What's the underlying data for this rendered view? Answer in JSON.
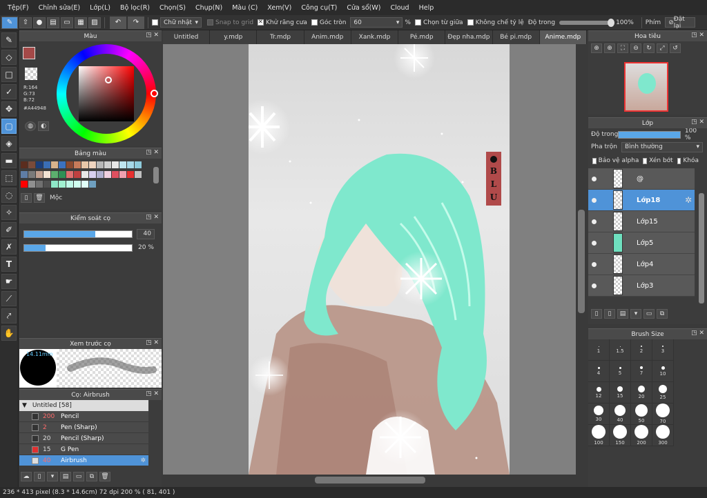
{
  "menu": [
    "Tệp(F)",
    "Chỉnh sửa(E)",
    "Lớp(L)",
    "Bộ lọc(R)",
    "Chọn(S)",
    "Chụp(N)",
    "Màu (C)",
    "Xem(V)",
    "Công cụ(T)",
    "Cửa sổ(W)",
    "Cloud",
    "Help"
  ],
  "toolbar": {
    "brush_mode": "Chữ nhật",
    "snap": "Snap to grid",
    "antialias": "Khử răng cưa",
    "corner": "Góc tròn",
    "corner_value": "60",
    "percent": "%",
    "select_center": "Chọn từ giữa",
    "no_ratio": "Không chế tỷ lệ",
    "opacity": "Độ trong",
    "opacity_value": "100%",
    "key": "Phím",
    "reset": "Đặt lại"
  },
  "color_panel": {
    "title": "Màu",
    "r": "R:164",
    "g": "G:73",
    "b": "B:72",
    "hex": "#A44948",
    "main_color": "#A44948"
  },
  "palette_panel": {
    "title": "Bảng màu",
    "name": "Mộc"
  },
  "brush_control": {
    "title": "Kiểm soát cọ",
    "size": "40",
    "opacity": "20 %",
    "size_fill": 0.66,
    "opacity_fill": 0.2
  },
  "brush_preview": {
    "title": "Xem trước cọ",
    "size_label": "14.11mm"
  },
  "brush_list": {
    "title": "Cọ: Airbrush",
    "group": "Untitled [58]",
    "items": [
      {
        "num": "200",
        "name": "Pencil",
        "color": "#333",
        "num_color": "#ff6b6b",
        "on": false
      },
      {
        "num": "2",
        "name": "Pen (Sharp)",
        "color": "#333",
        "num_color": "#ff6b6b",
        "on": false
      },
      {
        "num": "20",
        "name": "Pencil (Sharp)",
        "color": "#333",
        "num_color": "#ddd",
        "on": false
      },
      {
        "num": "15",
        "name": "G Pen",
        "color": "#e03030",
        "num_color": "#ddd",
        "on": false
      },
      {
        "num": "40",
        "name": "Airbrush",
        "color": "#ddd",
        "num_color": "#ff6b6b",
        "on": true
      }
    ]
  },
  "tabs": [
    "Untitled",
    "y.mdp",
    "Tr.mdp",
    "Anim.mdp",
    "Xank.mdp",
    "Pé.mdp",
    "Đẹp nha.mdp",
    "Bé pi.mdp",
    "Anime.mdp"
  ],
  "active_tab": 8,
  "navigator": {
    "title": "Hoa tiêu"
  },
  "layer_panel": {
    "title": "Lớp",
    "opacity_label": "Độ trong",
    "opacity_value": "100 %",
    "blend_label": "Pha trộn",
    "blend_value": "Bình thường",
    "protect_alpha": "Bảo vệ alpha",
    "clipping": "Xén bớt",
    "lock": "Khóa",
    "layers": [
      {
        "name": "@",
        "on": false
      },
      {
        "name": "Lớp18",
        "on": true
      },
      {
        "name": "Lớp15",
        "on": false
      },
      {
        "name": "Lớp5",
        "on": false
      },
      {
        "name": "Lớp4",
        "on": false
      },
      {
        "name": "Lớp3",
        "on": false
      }
    ]
  },
  "brush_size": {
    "title": "Brush Size",
    "sizes": [
      "1",
      "1.5",
      "2",
      "3",
      "4",
      "5",
      "7",
      "10",
      "12",
      "15",
      "20",
      "25",
      "30",
      "40",
      "50",
      "70",
      "100",
      "150",
      "200",
      "300"
    ]
  },
  "canvas": {
    "signature": [
      "B",
      "L",
      "U"
    ]
  },
  "status": "236 * 413 pixel   (8.3 * 14.6cm)   72 dpi   200 %   ( 81, 401 )"
}
